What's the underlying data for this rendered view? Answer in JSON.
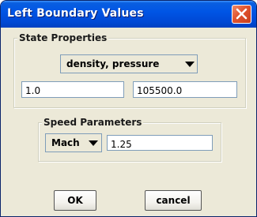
{
  "window": {
    "title": "Left Boundary Values"
  },
  "state_properties": {
    "title": "State Properties",
    "selected_option": "density, pressure",
    "value1": "1.0",
    "value2": "105500.0"
  },
  "speed_parameters": {
    "title": "Speed Parameters",
    "selected_option": "Mach",
    "value": "1.25"
  },
  "buttons": {
    "ok": "OK",
    "cancel": "cancel"
  },
  "colors": {
    "titlebar": "#0055e5",
    "background": "#ece9d8",
    "close_button": "#e0522d",
    "field_border": "#7f9db9"
  },
  "icons": {
    "close": "close-icon",
    "dropdown": "chevron-down-icon"
  }
}
